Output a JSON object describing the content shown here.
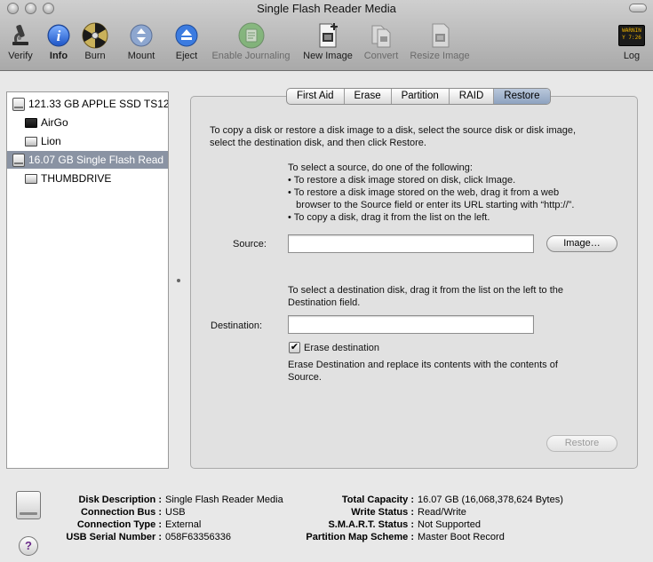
{
  "window": {
    "title": "Single Flash Reader Media"
  },
  "toolbar": {
    "items": [
      {
        "label": "Verify",
        "icon": "microscope-icon",
        "enabled": true
      },
      {
        "label": "Info",
        "icon": "info-icon",
        "enabled": true
      },
      {
        "label": "Burn",
        "icon": "burn-icon",
        "enabled": true
      },
      {
        "label": "Mount",
        "icon": "mount-icon",
        "enabled": true
      },
      {
        "label": "Eject",
        "icon": "eject-icon",
        "enabled": true
      },
      {
        "label": "Enable Journaling",
        "icon": "journal-icon",
        "enabled": false
      },
      {
        "label": "New Image",
        "icon": "new-image-icon",
        "enabled": true
      },
      {
        "label": "Convert",
        "icon": "convert-icon",
        "enabled": false
      },
      {
        "label": "Resize Image",
        "icon": "resize-image-icon",
        "enabled": false
      }
    ],
    "log_label": "Log",
    "log_icon_text": "WARNIN"
  },
  "sidebar": {
    "items": [
      {
        "label": "121.33 GB APPLE SSD TS12",
        "kind": "disk"
      },
      {
        "label": "AirGo",
        "kind": "volume-dark"
      },
      {
        "label": "Lion",
        "kind": "volume"
      },
      {
        "label": "16.07 GB Single Flash Read",
        "kind": "disk",
        "selected": true
      },
      {
        "label": "THUMBDRIVE",
        "kind": "volume"
      }
    ]
  },
  "tabs": [
    "First Aid",
    "Erase",
    "Partition",
    "RAID",
    "Restore"
  ],
  "active_tab": "Restore",
  "restore": {
    "intro_1": "To copy a disk or restore a disk image to a disk, select the source disk or disk image,",
    "intro_2": "select the destination disk, and then click Restore.",
    "source_help": [
      "To select a source, do one of the following:",
      "• To restore a disk image stored on disk, click Image.",
      "• To restore a disk image stored on the web, drag it from a web",
      "   browser to the Source field or enter its URL starting with “http://”.",
      "• To copy a disk, drag it from the list on the left."
    ],
    "source_label": "Source:",
    "source_value": "",
    "image_button": "Image…",
    "dest_help_1": "To select a destination disk, drag it from the list on the left to the",
    "dest_help_2": "Destination field.",
    "destination_label": "Destination:",
    "destination_value": "",
    "erase_checked": true,
    "erase_label": "Erase destination",
    "erase_desc_1": "Erase Destination and replace its contents with the contents of",
    "erase_desc_2": "Source.",
    "restore_button": "Restore"
  },
  "info": {
    "left": [
      {
        "key": "Disk Description :",
        "value": "Single Flash Reader Media"
      },
      {
        "key": "Connection Bus :",
        "value": "USB"
      },
      {
        "key": "Connection Type :",
        "value": "External"
      },
      {
        "key": "USB Serial Number :",
        "value": "058F63356336"
      }
    ],
    "right": [
      {
        "key": "Total Capacity :",
        "value": "16.07 GB (16,068,378,624 Bytes)"
      },
      {
        "key": "Write Status :",
        "value": "Read/Write"
      },
      {
        "key": "S.M.A.R.T. Status :",
        "value": "Not Supported"
      },
      {
        "key": "Partition Map Scheme :",
        "value": "Master Boot Record"
      }
    ],
    "help_glyph": "?"
  }
}
